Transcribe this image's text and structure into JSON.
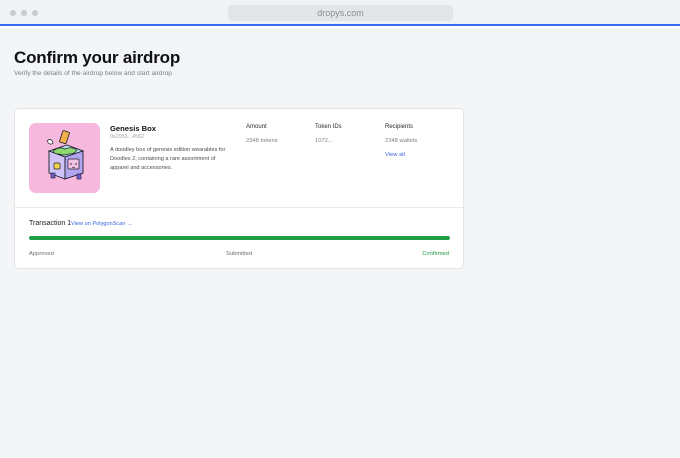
{
  "browser": {
    "url": "dropys.com"
  },
  "page": {
    "title": "Confirm your airdrop",
    "subtitle": "Verify the details of the airdrop below and start airdrop"
  },
  "collection": {
    "name": "Genesis Box",
    "address": "0x2953...4562",
    "description": "A doodley box of genesis edition wearables for Doodles 2, containing a rare assortment of apparel and accessories.",
    "image_icon": "genesis-box-icon"
  },
  "details": {
    "amount_label": "Amount",
    "amount_value": "2348 tokens",
    "token_ids_label": "Token IDs",
    "token_ids_value": "1072...",
    "recipients_label": "Recipients",
    "recipients_value": "2348 wallets",
    "view_all_label": "View all"
  },
  "transaction": {
    "label": "Transaction 1",
    "link_label": "View on PolygonScan →",
    "progress": 1.0,
    "steps": [
      "Approved",
      "Submitted",
      "Confirmed"
    ],
    "progress_color": "#1e9b45",
    "link_color": "#3a63e0"
  }
}
